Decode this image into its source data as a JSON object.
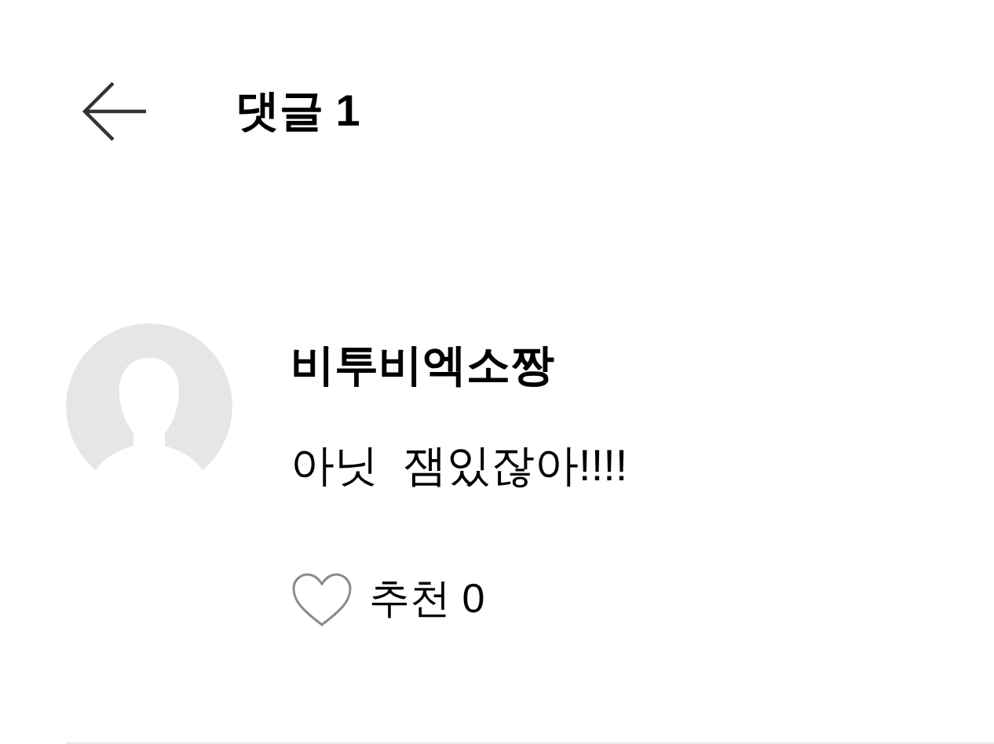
{
  "header": {
    "title": "댓글 1"
  },
  "comments": [
    {
      "author": "비투비엑소짱",
      "text": "아닛  잼있잖아!!!!",
      "likes_label": "추천 0",
      "liked": false
    }
  ]
}
